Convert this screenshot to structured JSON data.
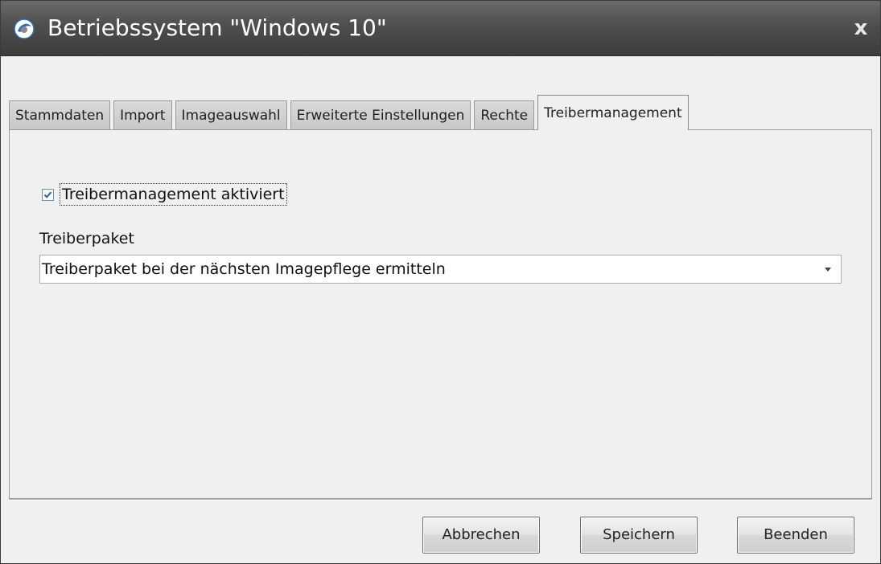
{
  "window": {
    "title": "Betriebssystem \"Windows 10\"",
    "close_label": "x"
  },
  "tabs": [
    {
      "label": "Stammdaten",
      "active": false
    },
    {
      "label": "Import",
      "active": false
    },
    {
      "label": "Imageauswahl",
      "active": false
    },
    {
      "label": "Erweiterte Einstellungen",
      "active": false
    },
    {
      "label": "Rechte",
      "active": false
    },
    {
      "label": "Treibermanagement",
      "active": true
    }
  ],
  "panel": {
    "checkbox": {
      "label": "Treibermanagement aktiviert",
      "checked": true
    },
    "driver_package": {
      "label": "Treiberpaket",
      "selected_value": "Treiberpaket bei der nächsten Imagepflege ermitteln"
    }
  },
  "buttons": {
    "cancel": "Abbrechen",
    "save": "Speichern",
    "quit": "Beenden"
  },
  "colors": {
    "titlebar": "#4e4e4e",
    "window_bg": "#f0f0f0",
    "checkmark": "#2d5f9a"
  },
  "icons": {
    "app": "app-logo-icon",
    "close": "close-icon",
    "dropdown": "chevron-down-icon",
    "check": "checkmark-icon"
  }
}
